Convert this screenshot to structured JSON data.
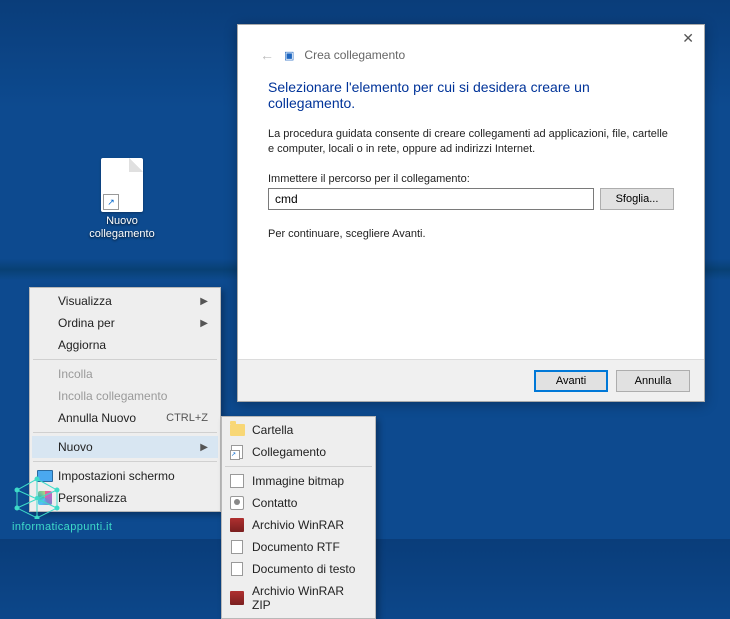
{
  "desktop": {
    "icon_label": "Nuovo collegamento"
  },
  "context_menu": {
    "items": [
      {
        "label": "Visualizza",
        "arrow": true
      },
      {
        "label": "Ordina per",
        "arrow": true
      },
      {
        "label": "Aggiorna"
      },
      {
        "sep": true
      },
      {
        "label": "Incolla",
        "disabled": true
      },
      {
        "label": "Incolla collegamento",
        "disabled": true
      },
      {
        "label": "Annulla Nuovo",
        "kb": "CTRL+Z"
      },
      {
        "sep": true
      },
      {
        "label": "Nuovo",
        "arrow": true,
        "highlight": true
      },
      {
        "sep": true
      },
      {
        "label": "Impostazioni schermo",
        "icon": "display-icon"
      },
      {
        "label": "Personalizza",
        "icon": "personalize-icon"
      }
    ]
  },
  "submenu": {
    "items": [
      {
        "label": "Cartella",
        "icon": "folder-icon"
      },
      {
        "label": "Collegamento",
        "icon": "shortcut-icon"
      },
      {
        "sep": true
      },
      {
        "label": "Immagine bitmap",
        "icon": "bitmap-icon"
      },
      {
        "label": "Contatto",
        "icon": "contact-icon"
      },
      {
        "label": "Archivio WinRAR",
        "icon": "rar-icon"
      },
      {
        "label": "Documento RTF",
        "icon": "file-icon"
      },
      {
        "label": "Documento di testo",
        "icon": "file-icon"
      },
      {
        "label": "Archivio WinRAR ZIP",
        "icon": "rar-icon"
      }
    ]
  },
  "dialog": {
    "breadcrumb": "Crea collegamento",
    "headline": "Selezionare l'elemento per cui si desidera creare un collegamento.",
    "description": "La procedura guidata consente di creare collegamenti ad applicazioni, file, cartelle e computer, locali o in rete, oppure ad indirizzi Internet.",
    "field_label": "Immettere il percorso per il collegamento:",
    "field_value": "cmd",
    "browse_label": "Sfoglia...",
    "continue_text": "Per continuare, scegliere Avanti.",
    "next_label": "Avanti",
    "cancel_label": "Annulla"
  },
  "watermark": {
    "text": "informaticappunti.it"
  }
}
